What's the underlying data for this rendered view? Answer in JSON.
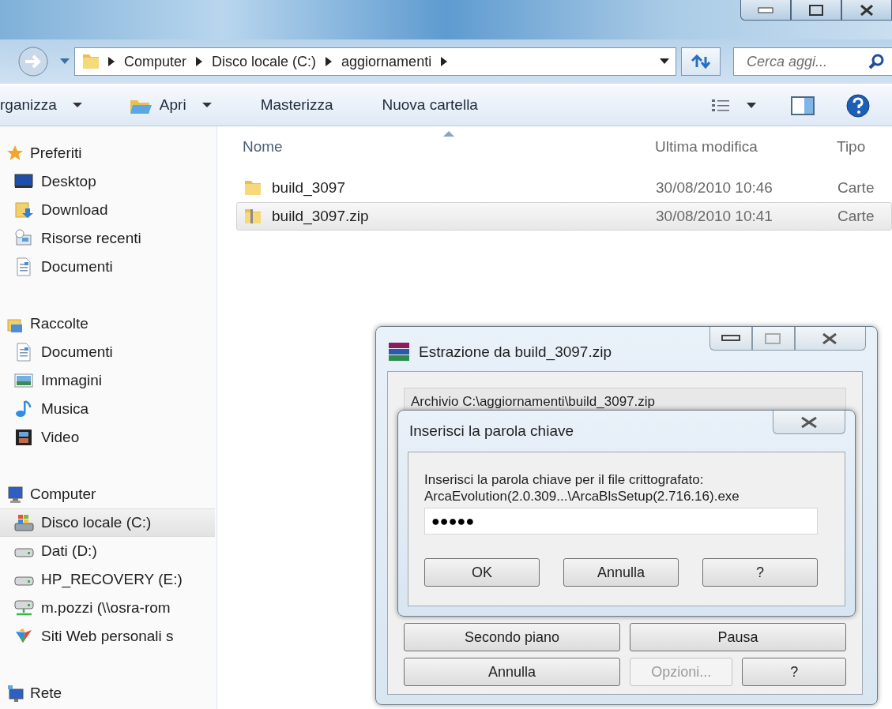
{
  "address": {
    "crumbs": [
      "Computer",
      "Disco locale (C:)",
      "aggiornamenti"
    ],
    "search_placeholder": "Cerca aggi..."
  },
  "toolbar": [
    {
      "label": "rganizza",
      "dropdown": true,
      "kind": "plain"
    },
    {
      "label": "Apri",
      "dropdown": true,
      "kind": "open"
    },
    {
      "label": "Masterizza",
      "dropdown": false,
      "kind": "plain"
    },
    {
      "label": "Nuova cartella",
      "dropdown": false,
      "kind": "plain"
    }
  ],
  "sidebar": [
    {
      "label": "Preferiti",
      "kind": "star",
      "children": [
        {
          "label": "Desktop",
          "kind": "desktop",
          "selected": false
        },
        {
          "label": "Download",
          "kind": "download",
          "selected": false
        },
        {
          "label": "Risorse recenti",
          "kind": "recent",
          "selected": false
        },
        {
          "label": "Documenti",
          "kind": "doc",
          "selected": false
        }
      ]
    },
    {
      "label": "Raccolte",
      "kind": "library",
      "children": [
        {
          "label": "Documenti",
          "kind": "doc",
          "selected": false
        },
        {
          "label": "Immagini",
          "kind": "image",
          "selected": false
        },
        {
          "label": "Musica",
          "kind": "music",
          "selected": false
        },
        {
          "label": "Video",
          "kind": "video",
          "selected": false
        }
      ]
    },
    {
      "label": "Computer",
      "kind": "computer",
      "children": [
        {
          "label": "Disco locale (C:)",
          "kind": "sysdrive",
          "selected": true
        },
        {
          "label": "Dati (D:)",
          "kind": "drive",
          "selected": false
        },
        {
          "label": "HP_RECOVERY (E:)",
          "kind": "drive",
          "selected": false
        },
        {
          "label": "m.pozzi (\\\\osra-rom",
          "kind": "netdrive",
          "selected": false
        },
        {
          "label": "Siti Web personali s",
          "kind": "web",
          "selected": false
        }
      ]
    },
    {
      "label": "Rete",
      "kind": "network"
    }
  ],
  "columns": [
    {
      "label": "Nome",
      "sorted": true
    },
    {
      "label": "Ultima modifica",
      "sorted": false
    },
    {
      "label": "Tipo",
      "sorted": false
    }
  ],
  "files": [
    {
      "name": "build_3097",
      "modified": "30/08/2010 10:46",
      "type": "Carte",
      "kind": "folder",
      "selected": false
    },
    {
      "name": "build_3097.zip",
      "modified": "30/08/2010 10:41",
      "type": "Carte",
      "kind": "zip",
      "selected": true
    }
  ],
  "extract_dialog": {
    "title": "Estrazione da build_3097.zip",
    "archive": "Archivio C:\\aggiornamenti\\build_3097.zip",
    "button_rows": [
      [
        {
          "label": "Secondo piano",
          "disabled": false
        },
        {
          "label": "Pausa",
          "disabled": false
        }
      ],
      [
        {
          "label": "Annulla",
          "disabled": false
        },
        {
          "label": "Opzioni...",
          "disabled": true
        },
        {
          "label": "?",
          "disabled": false
        }
      ]
    ]
  },
  "password_dialog": {
    "title": "Inserisci la parola chiave",
    "prompt": [
      "Inserisci la parola chiave per il file crittografato:",
      "ArcaEvolution(2.0.309...\\ArcaBlsSetup(2.716.16).exe"
    ],
    "value": "●●●●●",
    "buttons": [
      "OK",
      "Annulla",
      "?"
    ]
  }
}
